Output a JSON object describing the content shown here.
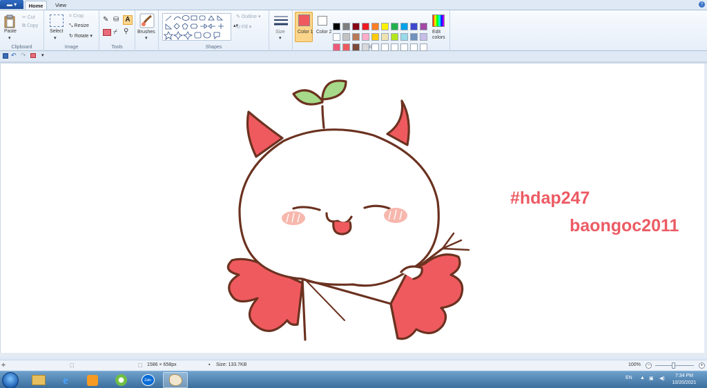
{
  "app": {
    "menu_icon": "paint-app-menu-icon",
    "tabs": [
      "Home",
      "View"
    ]
  },
  "ribbon": {
    "clipboard": {
      "label": "Clipboard",
      "paste": "Paste",
      "cut": "Cut",
      "copy": "Copy"
    },
    "image": {
      "label": "Image",
      "select": "Select",
      "crop": "Crop",
      "resize": "Resize",
      "rotate": "Rotate"
    },
    "tools": {
      "label": "Tools"
    },
    "brushes": {
      "label": "Brushes"
    },
    "shapes": {
      "label": "Shapes",
      "outline": "Outline",
      "fill": "Fill"
    },
    "size": {
      "label": "Size"
    },
    "colors": {
      "label": "Colors",
      "color1": "Color 1",
      "color2": "Color 2",
      "edit_colors": "Edit colors",
      "color1_value": "#ef5a5f",
      "color2_value": "#ffffff",
      "palette_row1": [
        "#000000",
        "#7f7f7f",
        "#880015",
        "#ed1c24",
        "#ff7f27",
        "#fff200",
        "#22b14c",
        "#00a2e8",
        "#3f48cc",
        "#a349a4"
      ],
      "palette_row2": [
        "#ffffff",
        "#c3c3c3",
        "#b97a57",
        "#ffaec9",
        "#ffc90e",
        "#efe4b0",
        "#b5e61d",
        "#99d9ea",
        "#7092be",
        "#c8bfe7"
      ],
      "palette_row3": [
        "#ef5a7a",
        "#ef5a5f",
        "#7a4a3a",
        "#d8d8d8",
        "#ffffff",
        "#ffffff",
        "#ffffff",
        "#ffffff",
        "#ffffff",
        "#ffffff"
      ]
    }
  },
  "canvas": {
    "watermark_1": "#hdap247",
    "watermark_2": "baongoc2011"
  },
  "status": {
    "dimensions": "1586 × 658px",
    "size": "Size: 133.7KB",
    "zoom": "100%"
  },
  "taskbar": {
    "lang": "EN",
    "time": "7:34 PM",
    "date": "10/20/2021"
  }
}
